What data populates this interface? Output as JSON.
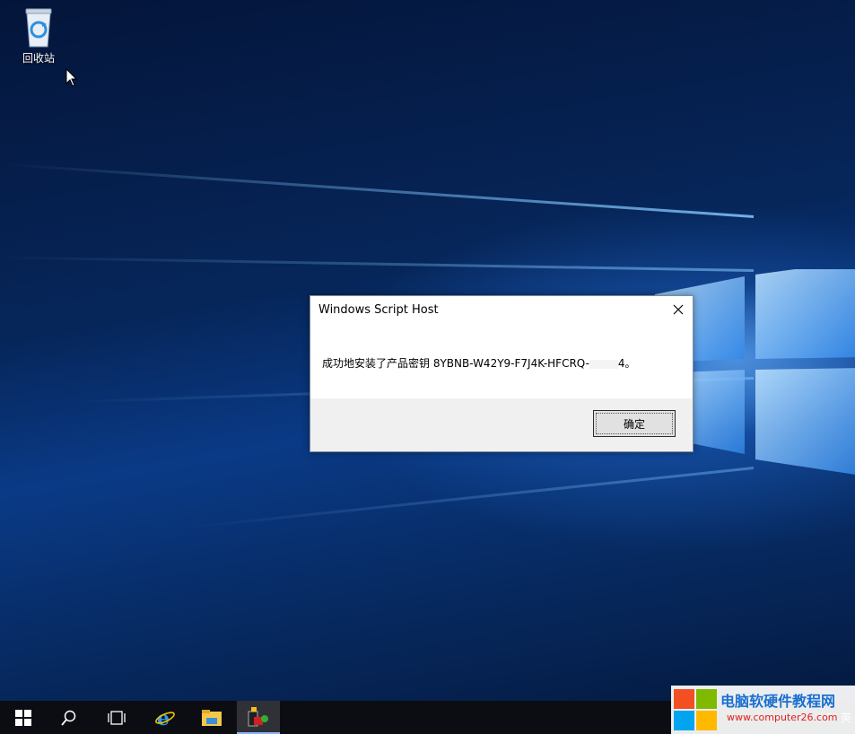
{
  "desktop": {
    "icons": [
      {
        "name": "recycle-bin",
        "label": "回收站"
      }
    ]
  },
  "dialog": {
    "title": "Windows Script Host",
    "message": "成功地安装了产品密钥 8YBNB-W42Y9-F7J4K-HFCRQ-",
    "message_end": "4。",
    "ok_label": "确定",
    "close_icon": "close-icon"
  },
  "taskbar": {
    "buttons": [
      {
        "name": "start-button",
        "icon": "windows-logo-icon"
      },
      {
        "name": "search-button",
        "icon": "search-icon"
      },
      {
        "name": "task-view-button",
        "icon": "task-view-icon"
      },
      {
        "name": "edge-ie-button",
        "icon": "internet-explorer-icon"
      },
      {
        "name": "file-explorer-button",
        "icon": "folder-icon"
      },
      {
        "name": "app-button",
        "icon": "app-icon"
      }
    ],
    "tray": {
      "chevron": "^",
      "ime": "英"
    }
  },
  "watermark": {
    "title": "电脑软硬件教程网",
    "url": "www.computer26.com"
  },
  "colors": {
    "accent": "#1a6fd0",
    "taskbar": "#0b0d12",
    "dialog_footer": "#f0f0f0"
  }
}
